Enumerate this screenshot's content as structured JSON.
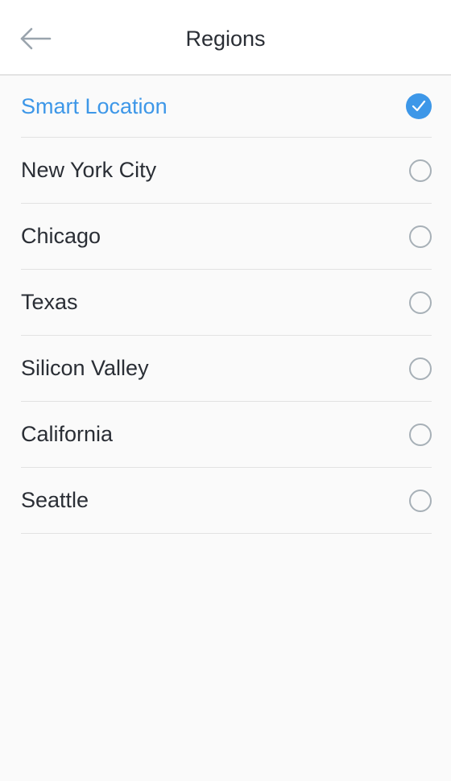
{
  "header": {
    "title": "Regions",
    "back_icon": "back-arrow-icon"
  },
  "colors": {
    "accent": "#3d97e8",
    "text": "#2a2e35",
    "radio_border": "#a7b0b7"
  },
  "regions": [
    {
      "label": "Smart Location",
      "selected": true
    },
    {
      "label": "New York City",
      "selected": false
    },
    {
      "label": "Chicago",
      "selected": false
    },
    {
      "label": "Texas",
      "selected": false
    },
    {
      "label": "Silicon Valley",
      "selected": false
    },
    {
      "label": "California",
      "selected": false
    },
    {
      "label": "Seattle",
      "selected": false
    }
  ]
}
